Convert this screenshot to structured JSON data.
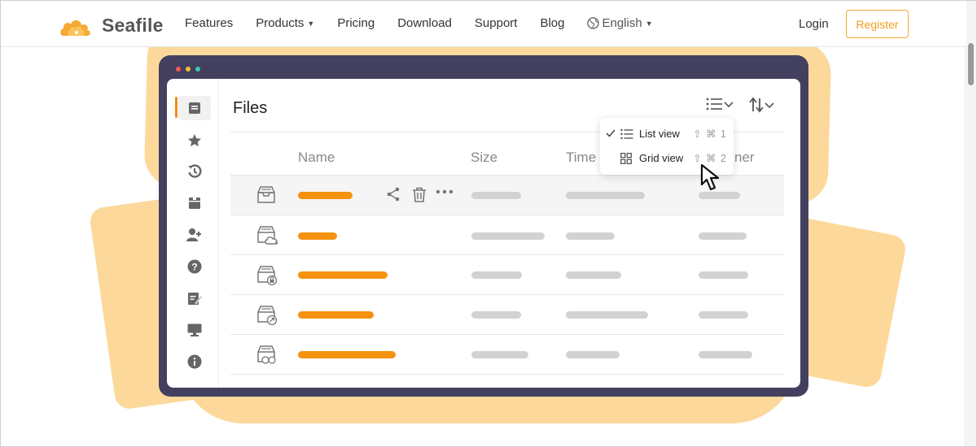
{
  "brand": {
    "name": "Seafile",
    "accent": "#f29f1c"
  },
  "nav": {
    "items": [
      {
        "label": "Features",
        "dropdown": false
      },
      {
        "label": "Products",
        "dropdown": true
      },
      {
        "label": "Pricing",
        "dropdown": false
      },
      {
        "label": "Download",
        "dropdown": false
      },
      {
        "label": "Support",
        "dropdown": false
      },
      {
        "label": "Blog",
        "dropdown": false
      }
    ],
    "language": "English",
    "login": "Login",
    "register": "Register"
  },
  "mockup": {
    "title": "Files",
    "sidebar_icons": [
      "file-icon",
      "star-icon",
      "history-icon",
      "archive-icon",
      "add-user-icon",
      "help-icon",
      "edit-icon",
      "monitor-icon",
      "info-icon"
    ],
    "columns": [
      "Name",
      "Size",
      "Time",
      "ner"
    ],
    "view_menu": [
      {
        "label": "List view",
        "checked": true,
        "shortcut": "⇧ ⌘ 1",
        "icon": "list-icon"
      },
      {
        "label": "Grid view",
        "checked": false,
        "shortcut": "⇧ ⌘ 2",
        "icon": "grid-icon"
      }
    ],
    "row_icons": [
      "library-icon",
      "cloud-library-icon",
      "locked-library-icon",
      "shared-library-icon",
      "group-library-icon"
    ]
  }
}
